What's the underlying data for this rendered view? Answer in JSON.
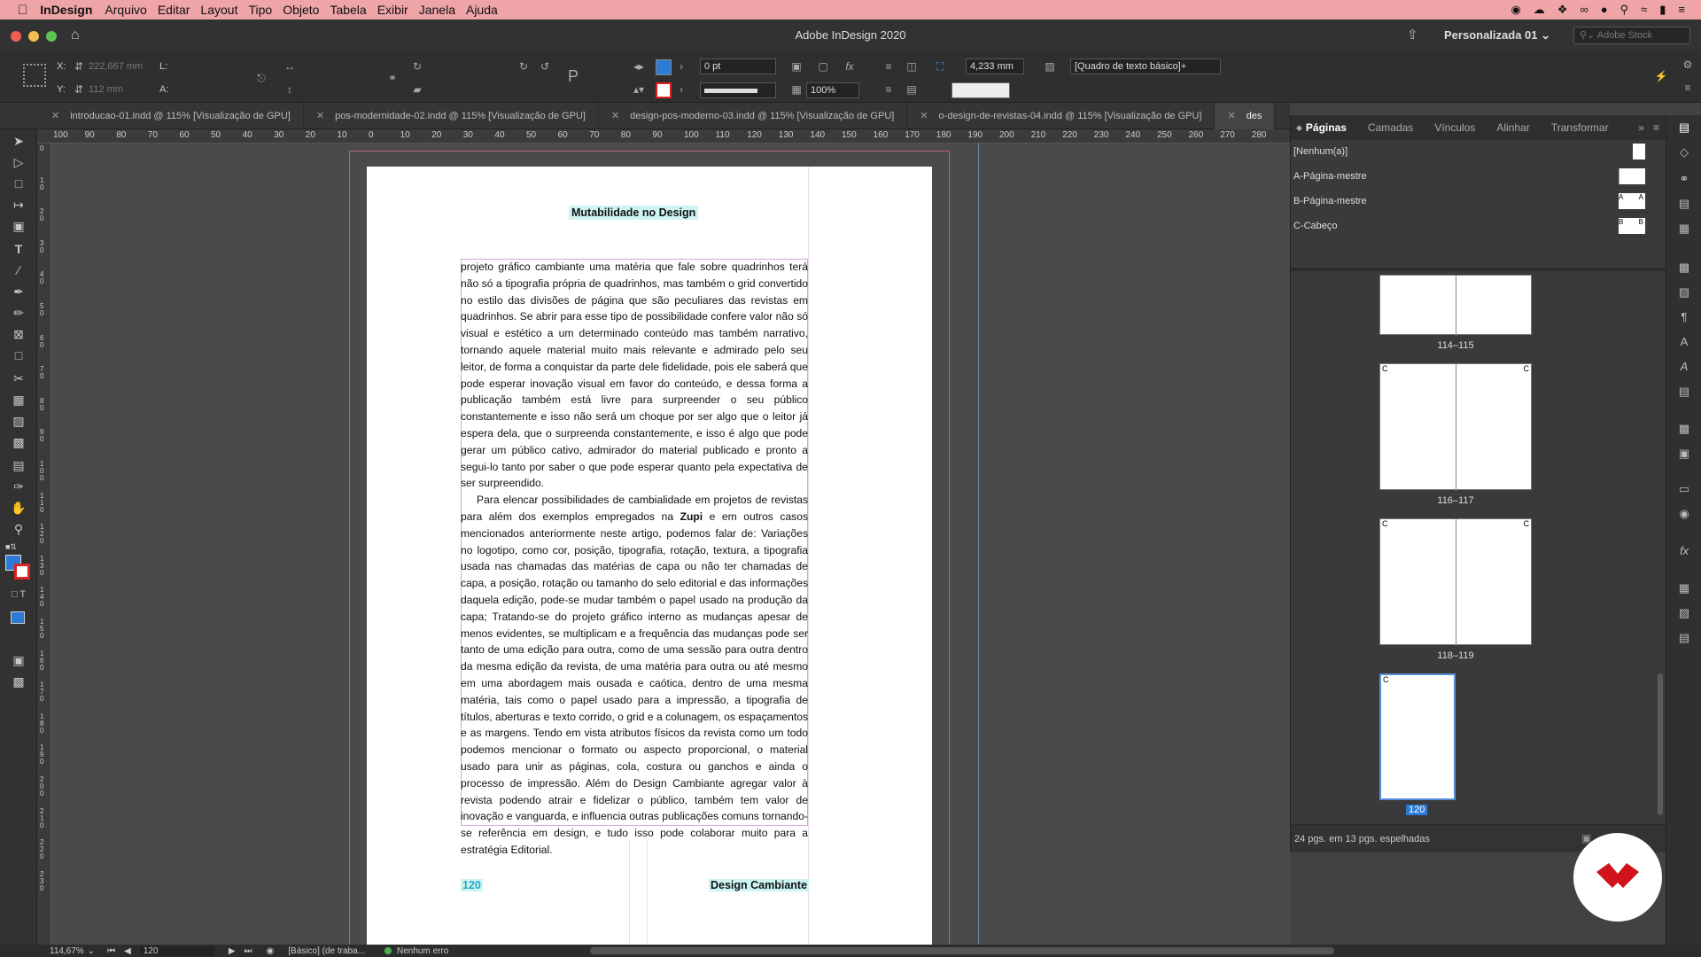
{
  "menubar": {
    "app_name": "InDesign",
    "items": [
      "Arquivo",
      "Editar",
      "Layout",
      "Tipo",
      "Objeto",
      "Tabela",
      "Exibir",
      "Janela",
      "Ajuda"
    ]
  },
  "window": {
    "title": "Adobe InDesign 2020",
    "workspace": "Personalizada 01",
    "search_placeholder": "Adobe Stock"
  },
  "control": {
    "x_label": "X:",
    "x_value": "222,667 mm",
    "y_label": "Y:",
    "y_value": "112 mm",
    "l_label": "L:",
    "a_label": "A:",
    "stroke_weight": "0 pt",
    "zoom_pct": "100%",
    "gutter_value": "4,233 mm",
    "object_style": "[Quadro de texto básico]+"
  },
  "tabs": [
    {
      "label": "introducao-01.indd @ 115% [Visualização de GPU]"
    },
    {
      "label": "pos-modernidade-02.indd @ 115% [Visualização de GPU]"
    },
    {
      "label": "design-pos-moderno-03.indd @ 115% [Visualização de GPU]"
    },
    {
      "label": "o-design-de-revistas-04.indd @ 115% [Visualização de GPU]"
    },
    {
      "label": "des"
    }
  ],
  "ruler": {
    "h_ticks": [
      "100",
      "90",
      "80",
      "70",
      "60",
      "50",
      "40",
      "30",
      "20",
      "10",
      "0",
      "10",
      "20",
      "30",
      "40",
      "50",
      "60",
      "70",
      "80",
      "90",
      "100",
      "110",
      "120",
      "130",
      "140",
      "150",
      "160",
      "170",
      "180",
      "190",
      "200",
      "210",
      "220",
      "230",
      "240",
      "250",
      "260",
      "270",
      "280"
    ],
    "v_ticks": [
      "0",
      "10",
      "20",
      "30",
      "40",
      "50",
      "60",
      "70",
      "80",
      "90",
      "100",
      "110",
      "120",
      "130",
      "140",
      "150",
      "160",
      "170",
      "180",
      "190",
      "200",
      "210",
      "220",
      "230"
    ]
  },
  "document": {
    "header": "Mutabilidade no Design",
    "paragraph1": "projeto gráfico cambiante uma matéria que fale sobre quadrinhos terá não só a tipografia própria de quadrinhos, mas também o grid convertido no estilo das divisões de página que são peculiares das revistas em quadrinhos. Se abrir para esse tipo de possibilidade confere valor não só visual e estético a um determinado conteúdo mas também narrativo, tornando aquele material muito mais relevante e admirado pelo seu leitor, de forma a conquistar da parte dele fidelidade, pois ele saberá que pode esperar inovação visual em favor do conteúdo, e dessa forma a publicação também está livre para surpreender o seu público constantemente e isso não será um choque por ser algo que o leitor já espera dela, que o surpreenda constantemente, e isso é algo que pode gerar um público cativo, admirador do material publicado e pronto a segui-lo tanto por saber o que pode esperar quanto pela expectativa de ser surpreendido.",
    "paragraph2_before": "Para elencar possibilidades de cambialidade em projetos de revistas para além dos exemplos empregados na ",
    "paragraph2_bold": "Zupi",
    "paragraph2_after": " e em outros casos mencionados anteriormente neste artigo, podemos falar de: Variações no logotipo, como cor, posição, tipografia, rotação, textura, a tipografia usada nas chamadas das matérias de capa ou não ter chamadas de capa, a posição, rotação ou tamanho do selo editorial e das informações daquela edição, pode-se mudar também o papel usado na produção da capa; Tratando-se do projeto gráfico interno as mudanças apesar de menos evidentes, se multiplicam e a frequência das mudanças pode ser tanto de uma edição para outra, como de uma sessão para outra dentro da mesma edição da revista, de uma matéria para outra ou até mesmo em uma abordagem mais ousada e caótica, dentro de uma mesma matéria, tais como o papel usado para a impressão, a tipografia de títulos, aberturas e texto corrido, o grid e a colunagem, os espaçamentos e as margens. Tendo em vista atributos físicos da revista como um todo podemos mencionar o formato ou aspecto proporcional, o material usado para unir as páginas, cola, costura ou ganchos e ainda o processo de impressão. Além do Design Cambiante agregar valor à revista podendo atrair e fidelizar o público, também tem valor de inovação e vanguarda, e influencia outras publicações comuns tornando-se referência em design, e tudo isso pode colaborar muito para a estratégia Editorial.",
    "page_number": "120",
    "footer": "Design Cambiante"
  },
  "panel": {
    "tabs": [
      "Páginas",
      "Camadas",
      "Vínculos",
      "Alinhar",
      "Transformar"
    ],
    "masters": [
      {
        "label": "[Nenhum(a)]"
      },
      {
        "label": "A-Página-mestre"
      },
      {
        "label": "B-Página-mestre"
      },
      {
        "label": "C-Cabeço"
      }
    ],
    "spreads": [
      "114–115",
      "116–117",
      "118–119",
      "120"
    ],
    "master_letter": "C",
    "letter_a": "A",
    "letter_b": "B",
    "footer": "24 pgs. em 13 pgs. espelhadas"
  },
  "status": {
    "zoom": "114,67%",
    "page_field": "120",
    "profile": "[Básico] (de traba...",
    "preflight": "Nenhum erro"
  },
  "colors": {
    "menubar": "#efa4a7",
    "accent": "#2c7bd6",
    "highlight": "#cdf4f2",
    "page_number": "#27a6c4",
    "preflight_ok": "#4bb34b",
    "brand_logo": "#d0141c"
  }
}
